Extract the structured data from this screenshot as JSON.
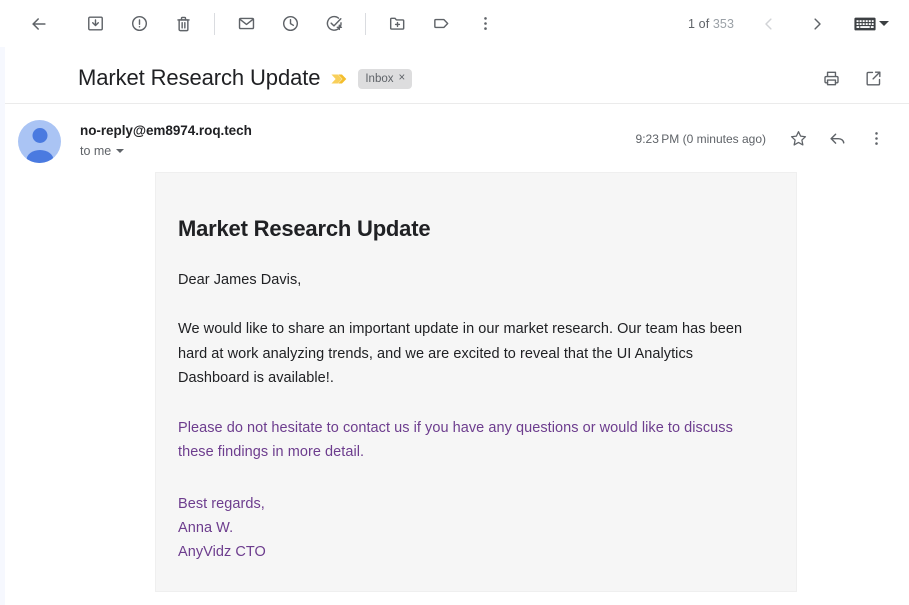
{
  "toolbar": {
    "back_label": "Back to Inbox",
    "actions": [
      {
        "name": "archive-icon",
        "label": "Archive"
      },
      {
        "name": "report-spam-icon",
        "label": "Report spam"
      },
      {
        "name": "delete-icon",
        "label": "Delete"
      },
      {
        "name": "mark-unread-icon",
        "label": "Mark as unread"
      },
      {
        "name": "snooze-icon",
        "label": "Snooze"
      },
      {
        "name": "add-to-tasks-icon",
        "label": "Add to tasks"
      },
      {
        "name": "move-to-icon",
        "label": "Move to"
      },
      {
        "name": "labels-icon",
        "label": "Labels"
      },
      {
        "name": "more-options-icon",
        "label": "More"
      }
    ],
    "counter": "1 of 353",
    "counter_current": "1 of ",
    "counter_total": "353",
    "newer_label": "Newer",
    "older_label": "Older",
    "keyboard_label": "Keyboard / input tools"
  },
  "header": {
    "subject": "Market Research Update",
    "important_marker_label": "Marked as important",
    "label_chip": "Inbox",
    "label_chip_remove": "×",
    "print_label": "Print all",
    "open_new_window_label": "Open in new window"
  },
  "message": {
    "sender": "no-reply@em8974.roq.tech",
    "recipient": "to me",
    "timestamp": "9:23 PM (0 minutes ago)",
    "star_label": "Star",
    "reply_label": "Reply",
    "more_label": "More"
  },
  "body": {
    "heading": "Market Research Update",
    "greeting": "Dear James Davis,",
    "paragraph_1": "We would like to share an important update in our market research. Our team has been hard at work analyzing trends, and we are excited to reveal that the UI Analytics Dashboard is available!.",
    "paragraph_2": "Please do not hesitate to contact us if you have any questions or would like to discuss these findings in more detail.",
    "signature_line_1": "Best regards,",
    "signature_line_2": "Anna W.",
    "signature_line_3": "AnyVidz CTO"
  },
  "colors": {
    "text_primary": "#202124",
    "text_secondary": "#5f6368",
    "link_purple": "#6d3d8e",
    "important_yellow": "#f4c025",
    "avatar_bg": "#aac4f4",
    "avatar_fg": "#4a7ae0",
    "body_bg": "#f6f6f6"
  }
}
